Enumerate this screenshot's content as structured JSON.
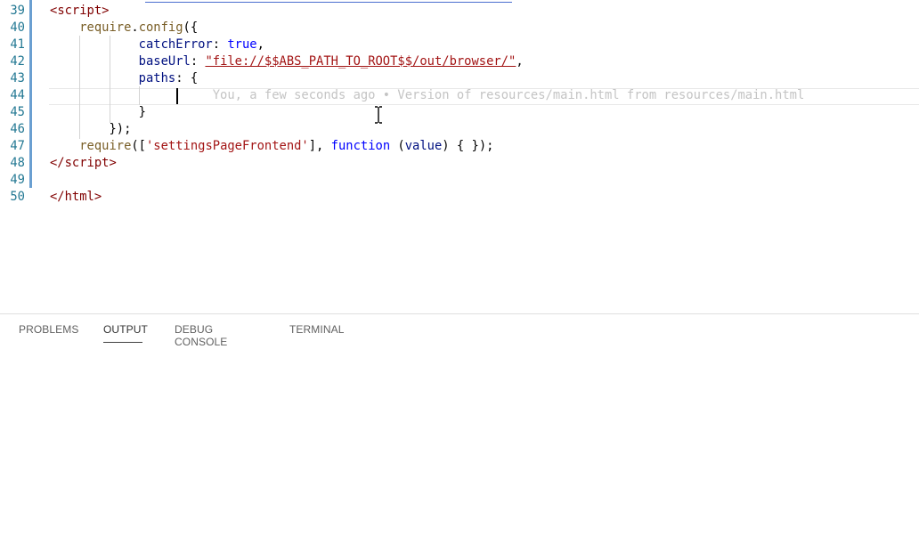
{
  "editor": {
    "lines": [
      {
        "num": "39",
        "parts": [
          {
            "t": "<",
            "c": "tagdelim"
          },
          {
            "t": "script",
            "c": "tag"
          },
          {
            "t": ">",
            "c": "tagdelim"
          }
        ]
      },
      {
        "num": "40",
        "parts": [
          {
            "t": "    require",
            "c": "fn"
          },
          {
            "t": ".",
            "c": "plain"
          },
          {
            "t": "config",
            "c": "fn"
          },
          {
            "t": "({",
            "c": "plain"
          }
        ]
      },
      {
        "num": "41",
        "parts": [
          {
            "t": "            catchError",
            "c": "prop"
          },
          {
            "t": ": ",
            "c": "plain"
          },
          {
            "t": "true",
            "c": "kw"
          },
          {
            "t": ",",
            "c": "plain"
          }
        ]
      },
      {
        "num": "42",
        "parts": [
          {
            "t": "            baseUrl",
            "c": "prop"
          },
          {
            "t": ": ",
            "c": "plain"
          },
          {
            "t": "\"file://$$ABS_PATH_TO_ROOT$$/out/browser/\"",
            "c": "str ul"
          },
          {
            "t": ",",
            "c": "plain"
          }
        ]
      },
      {
        "num": "43",
        "parts": [
          {
            "t": "            paths",
            "c": "prop"
          },
          {
            "t": ": {",
            "c": "plain"
          }
        ]
      },
      {
        "num": "44",
        "parts": [
          {
            "t": "                      You, a few seconds ago • Version of resources/main.html from resources/main.html",
            "c": "ghost"
          }
        ]
      },
      {
        "num": "45",
        "parts": [
          {
            "t": "            }",
            "c": "plain"
          }
        ]
      },
      {
        "num": "46",
        "parts": [
          {
            "t": "        });",
            "c": "plain"
          }
        ]
      },
      {
        "num": "47",
        "parts": [
          {
            "t": "    require",
            "c": "fn"
          },
          {
            "t": "([",
            "c": "plain"
          },
          {
            "t": "'settingsPageFrontend'",
            "c": "str"
          },
          {
            "t": "], ",
            "c": "plain"
          },
          {
            "t": "function",
            "c": "kw"
          },
          {
            "t": " (",
            "c": "plain"
          },
          {
            "t": "value",
            "c": "prop"
          },
          {
            "t": ") { });",
            "c": "plain"
          }
        ]
      },
      {
        "num": "48",
        "parts": [
          {
            "t": "</",
            "c": "tagdelim"
          },
          {
            "t": "script",
            "c": "tag"
          },
          {
            "t": ">",
            "c": "tagdelim"
          }
        ]
      },
      {
        "num": "49",
        "parts": []
      },
      {
        "num": "50",
        "parts": [
          {
            "t": "</",
            "c": "tagdelim"
          },
          {
            "t": "html",
            "c": "tag"
          },
          {
            "t": ">",
            "c": "tagdelim"
          }
        ]
      }
    ],
    "blame_hint": "You, a few seconds ago • Version of resources/main.html from resources/main.html"
  },
  "panel": {
    "tabs": [
      {
        "label": "PROBLEMS",
        "active": false
      },
      {
        "label": "OUTPUT",
        "active": true
      },
      {
        "label": "DEBUG CONSOLE",
        "active": false
      },
      {
        "label": "TERMINAL",
        "active": false
      }
    ]
  },
  "colors": {
    "line_number": "#237893",
    "gutter_modified": "#6a9fd1",
    "string": "#a31515",
    "keyword": "#0000ff",
    "tag": "#800000",
    "function": "#795e26",
    "property": "#001080"
  }
}
